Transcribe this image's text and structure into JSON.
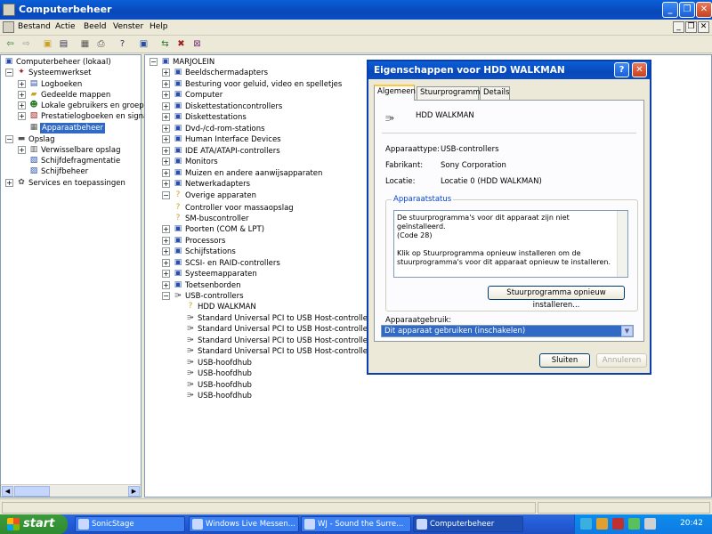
{
  "window": {
    "title": "Computerbeheer"
  },
  "menu": [
    "Bestand",
    "Actie",
    "Beeld",
    "Venster",
    "Help"
  ],
  "left_tree": {
    "root": "Computerbeheer (lokaal)",
    "group1": "Systeemwerkset",
    "items1": [
      "Logboeken",
      "Gedeelde mappen",
      "Lokale gebruikers en groeper",
      "Prestatielogboeken en signal",
      "Apparaatbeheer"
    ],
    "group2": "Opslag",
    "items2": [
      "Verwisselbare opslag",
      "Schijfdefragmentatie",
      "Schijfbeheer"
    ],
    "group3": "Services en toepassingen"
  },
  "device_tree": {
    "root": "MARJOLEIN",
    "categories": [
      "Beeldschermadapters",
      "Besturing voor geluid, video en spelletjes",
      "Computer",
      "Diskettestationcontrollers",
      "Diskettestations",
      "Dvd-/cd-rom-stations",
      "Human Interface Devices",
      "IDE ATA/ATAPI-controllers",
      "Monitors",
      "Muizen en andere aanwijsapparaten",
      "Netwerkadapters",
      "Overige apparaten"
    ],
    "other_devices": [
      "Controller voor massaopslag",
      "SM-buscontroller"
    ],
    "categories2": [
      "Poorten (COM & LPT)",
      "Processors",
      "Schijfstations",
      "SCSI- en RAID-controllers",
      "Systeemapparaten",
      "Toetsenborden",
      "USB-controllers"
    ],
    "usb_devices": [
      "HDD WALKMAN",
      "Standard Universal PCI to USB Host-controller",
      "Standard Universal PCI to USB Host-controller",
      "Standard Universal PCI to USB Host-controller",
      "Standard Universal PCI to USB Host-controller",
      "USB-hoofdhub",
      "USB-hoofdhub",
      "USB-hoofdhub",
      "USB-hoofdhub"
    ]
  },
  "dialog": {
    "title": "Eigenschappen voor HDD WALKMAN",
    "help": "?",
    "close": "✕",
    "tabs": [
      "Algemeen",
      "Stuurprogramma",
      "Details"
    ],
    "device_name": "HDD WALKMAN",
    "fields": [
      {
        "label": "Apparaattype:",
        "value": "USB-controllers"
      },
      {
        "label": "Fabrikant:",
        "value": "Sony Corporation"
      },
      {
        "label": "Locatie:",
        "value": "Locatie 0 (HDD WALKMAN)"
      }
    ],
    "status_group": "Apparaatstatus",
    "status_text": "De stuurprogramma's voor dit apparaat zijn niet geïnstalleerd.\n(Code 28)\n\nKlik op Stuurprogramma opnieuw installeren om de stuurprogramma's voor dit apparaat opnieuw te installeren.",
    "reinstall_button": "Stuurprogramma opnieuw installeren...",
    "usage_label": "Apparaatgebruik:",
    "usage_value": "Dit apparaat gebruiken (inschakelen)",
    "ok_button": "Sluiten",
    "cancel_button": "Annuleren"
  },
  "taskbar": {
    "start": "start",
    "tasks": [
      "SonicStage",
      "Windows Live Messen...",
      "WJ - Sound the Surre...",
      "Computerbeheer"
    ],
    "lang": "NL",
    "clock": "20:42"
  }
}
